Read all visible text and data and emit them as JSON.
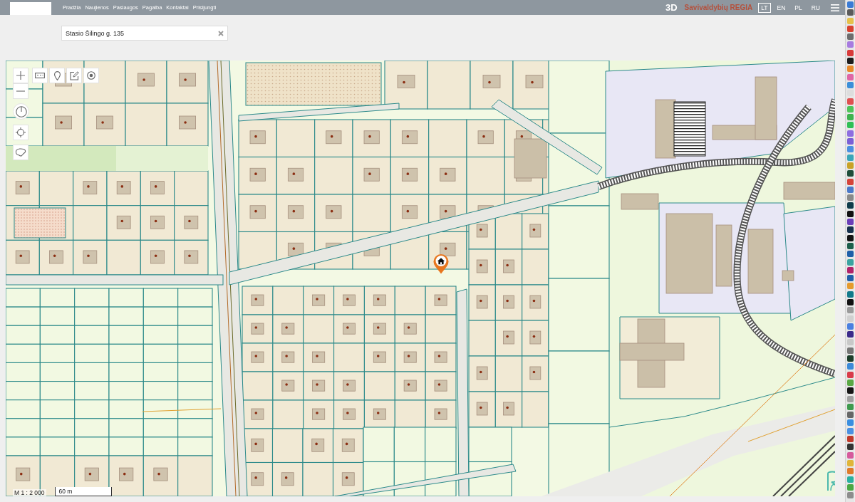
{
  "top_bar": {
    "nav": [
      "Pradžia",
      "Naujienos",
      "Paslaugos",
      "Pagalba",
      "Kontaktai",
      "Prisijungti"
    ],
    "view_3d": "3D",
    "brand": "Savivaldybių REGIA",
    "languages": [
      {
        "label": "LT",
        "selected": true
      },
      {
        "label": "EN",
        "selected": false
      },
      {
        "label": "PL",
        "selected": false
      },
      {
        "label": "RU",
        "selected": false
      }
    ]
  },
  "search": {
    "value": "Stasio Šilingo g. 135"
  },
  "map": {
    "scale": "M 1 : 2 000",
    "scale_bar": "60 m"
  }
}
